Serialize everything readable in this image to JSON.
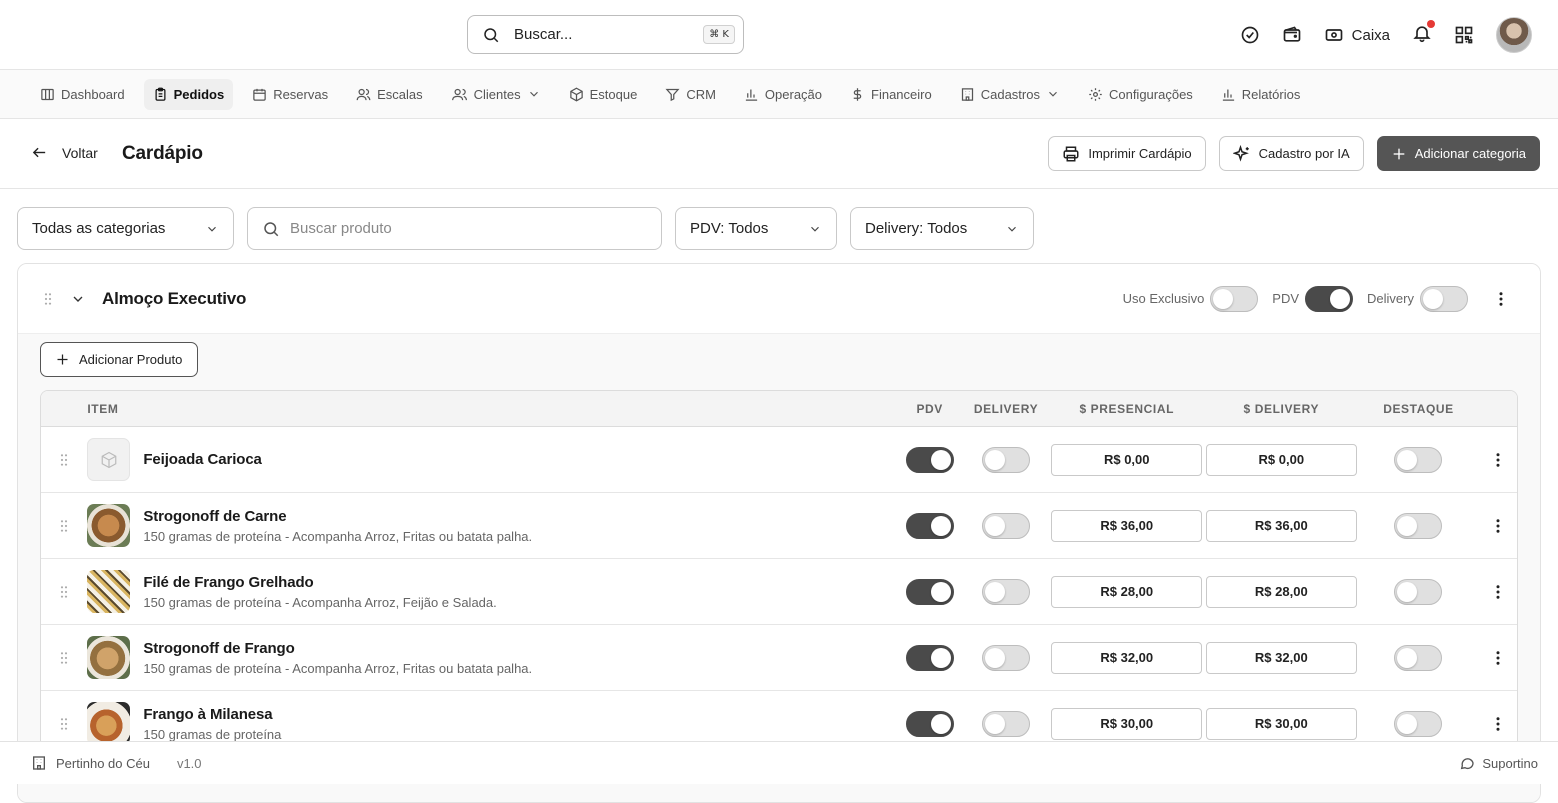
{
  "header": {
    "search_label": "Buscar...",
    "search_shortcut": "⌘ K",
    "caixa_label": "Caixa",
    "has_notification": true
  },
  "nav": {
    "items": [
      {
        "label": "Dashboard",
        "icon": "layout-icon"
      },
      {
        "label": "Pedidos",
        "icon": "clipboard-icon",
        "active": true
      },
      {
        "label": "Reservas",
        "icon": "calendar-icon"
      },
      {
        "label": "Escalas",
        "icon": "users-icon"
      },
      {
        "label": "Clientes",
        "icon": "user-group-icon",
        "dropdown": true
      },
      {
        "label": "Estoque",
        "icon": "box-icon"
      },
      {
        "label": "CRM",
        "icon": "funnel-icon"
      },
      {
        "label": "Operação",
        "icon": "bar-chart-icon"
      },
      {
        "label": "Financeiro",
        "icon": "dollar-icon"
      },
      {
        "label": "Cadastros",
        "icon": "building-icon",
        "dropdown": true
      },
      {
        "label": "Configurações",
        "icon": "gear-icon"
      },
      {
        "label": "Relatórios",
        "icon": "bar-chart-icon"
      }
    ]
  },
  "page": {
    "back_label": "Voltar",
    "title": "Cardápio",
    "print_label": "Imprimir Cardápio",
    "ai_label": "Cadastro por IA",
    "add_category_label": "Adicionar categoria"
  },
  "filters": {
    "category": "Todas as categorias",
    "search_placeholder": "Buscar produto",
    "search_value": "",
    "pdv": "PDV: Todos",
    "delivery": "Delivery: Todos"
  },
  "category": {
    "name": "Almoço Executivo",
    "exclusive_label": "Uso Exclusivo",
    "exclusive_on": false,
    "pdv_label": "PDV",
    "pdv_on": true,
    "delivery_label": "Delivery",
    "delivery_on": false,
    "add_product_label": "Adicionar Produto"
  },
  "table": {
    "columns": {
      "item": "ITEM",
      "pdv": "PDV",
      "delivery": "DELIVERY",
      "presencial": "$ PRESENCIAL",
      "price_delivery": "$ DELIVERY",
      "destaque": "DESTAQUE"
    },
    "rows": [
      {
        "name": "Feijoada Carioca",
        "desc": "",
        "image": "placeholder",
        "pdv": true,
        "delivery": false,
        "price_presencial": "R$ 0,00",
        "price_delivery": "R$ 0,00",
        "destaque": false
      },
      {
        "name": "Strogonoff de Carne",
        "desc": "150 gramas de proteína - Acompanha Arroz, Fritas ou batata palha.",
        "image": "food1",
        "pdv": true,
        "delivery": false,
        "price_presencial": "R$ 36,00",
        "price_delivery": "R$ 36,00",
        "destaque": false
      },
      {
        "name": "Filé de Frango Grelhado",
        "desc": "150 gramas de proteína - Acompanha Arroz, Feijão e Salada.",
        "image": "food2",
        "pdv": true,
        "delivery": false,
        "price_presencial": "R$ 28,00",
        "price_delivery": "R$ 28,00",
        "destaque": false
      },
      {
        "name": "Strogonoff de Frango",
        "desc": "150 gramas de proteína - Acompanha Arroz, Fritas ou batata palha.",
        "image": "food3",
        "pdv": true,
        "delivery": false,
        "price_presencial": "R$ 32,00",
        "price_delivery": "R$ 32,00",
        "destaque": false
      },
      {
        "name": "Frango à Milanesa",
        "desc": "150 gramas de proteína",
        "image": "food4",
        "pdv": true,
        "delivery": false,
        "price_presencial": "R$ 30,00",
        "price_delivery": "R$ 30,00",
        "destaque": false
      }
    ]
  },
  "footer": {
    "store_name": "Pertinho do Céu",
    "version": "v1.0",
    "support_label": "Suportino"
  },
  "colors": {
    "toggle_on": "#4a4a4a",
    "primary_button": "#555555",
    "notification_dot": "#e53935"
  }
}
